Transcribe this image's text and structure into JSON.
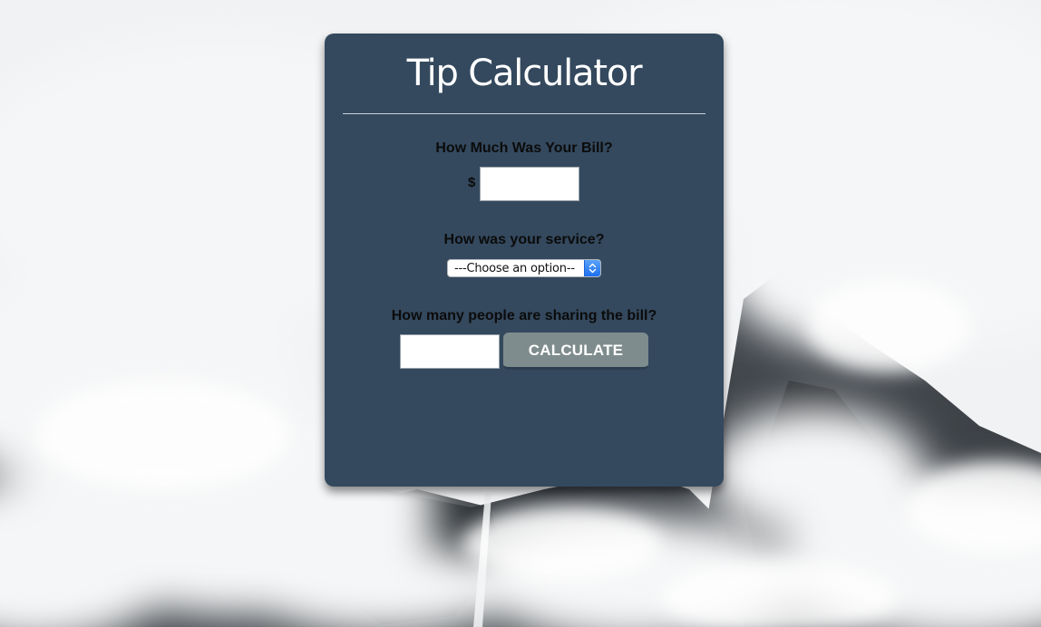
{
  "app": {
    "title": "Tip Calculator"
  },
  "bill": {
    "question": "How Much Was Your Bill?",
    "currency_symbol": "$",
    "value": ""
  },
  "service": {
    "question": "How was your service?",
    "selected_option": "---Choose an option--"
  },
  "people": {
    "question": "How many people are sharing the bill?",
    "value": ""
  },
  "actions": {
    "calculate_label": "CALCULATE"
  },
  "colors": {
    "card_background": "#34495e",
    "button_background": "#7f8c8d",
    "title_text": "#ffffff",
    "select_arrow_accent": "#1d6ff0"
  },
  "icons": {
    "select_arrows": "chevron-up-down-icon"
  }
}
